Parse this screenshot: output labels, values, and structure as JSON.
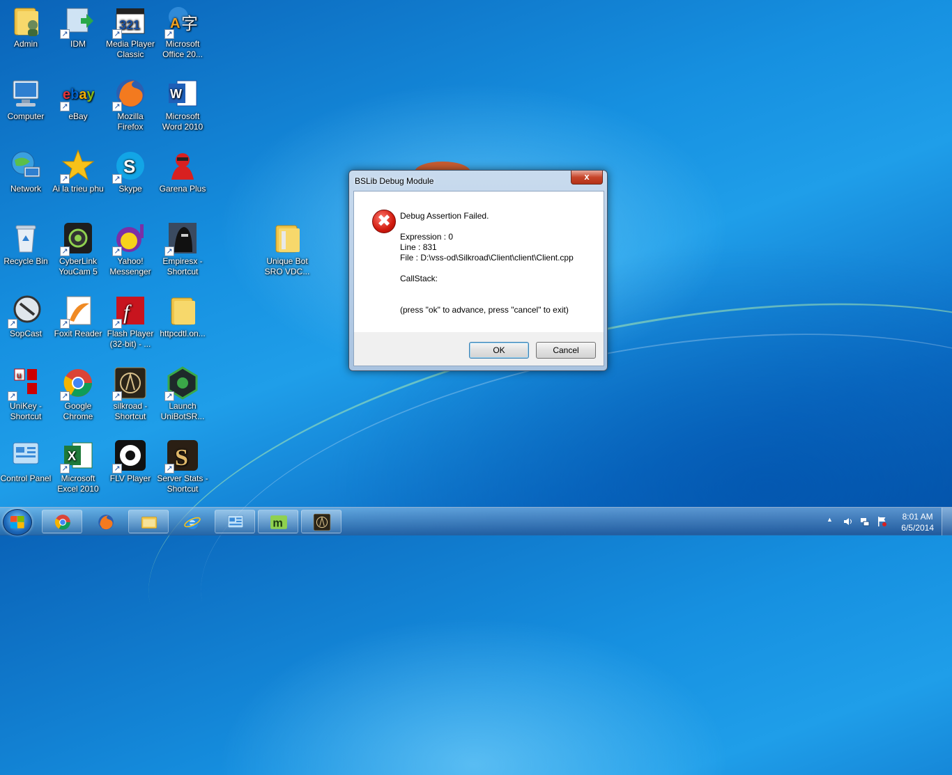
{
  "desktop": {
    "icons": [
      {
        "label": "Admin"
      },
      {
        "label": "IDM"
      },
      {
        "label": "Media Player Classic"
      },
      {
        "label": "Microsoft Office 20..."
      },
      {
        "label": "Computer"
      },
      {
        "label": "eBay"
      },
      {
        "label": "Mozilla Firefox"
      },
      {
        "label": "Microsoft Word 2010"
      },
      {
        "label": "Network"
      },
      {
        "label": "Ai la trieu phu"
      },
      {
        "label": "Skype"
      },
      {
        "label": "Garena Plus"
      },
      {
        "label": "Recycle Bin"
      },
      {
        "label": "CyberLink YouCam 5"
      },
      {
        "label": "Yahoo! Messenger"
      },
      {
        "label": "Empiresx - Shortcut"
      },
      {
        "label": "Unique Bot SRO VDC..."
      },
      {
        "label": "SopCast"
      },
      {
        "label": "Foxit Reader"
      },
      {
        "label": "Flash Player (32-bit) - ..."
      },
      {
        "label": "httpcdtl.on..."
      },
      {
        "label": "UniKey - Shortcut"
      },
      {
        "label": "Google Chrome"
      },
      {
        "label": "silkroad - Shortcut"
      },
      {
        "label": "Launch UniBotSR..."
      },
      {
        "label": "Control Panel"
      },
      {
        "label": "Microsoft Excel 2010"
      },
      {
        "label": "FLV Player"
      },
      {
        "label": "Server Stats - Shortcut"
      }
    ]
  },
  "dialog": {
    "title": "BSLib Debug Module",
    "close_glyph": "x",
    "error_glyph": "✖",
    "heading": "Debug Assertion Failed.",
    "expression": "Expression : 0",
    "line": "Line : 831",
    "file": "File : D:\\vss-od\\Silkroad\\Client\\client\\Client.cpp",
    "callstack": "CallStack:",
    "instruction": "(press \"ok\" to advance, press \"cancel\" to exit)",
    "ok_label": "OK",
    "cancel_label": "Cancel"
  },
  "taskbar": {
    "pinned": [
      "chrome-icon",
      "firefox-icon",
      "explorer-icon",
      "ie-icon",
      "control-panel-icon",
      "unibot-icon",
      "silkroad-icon"
    ],
    "tray": {
      "chevron": "▲",
      "time": "8:01 AM",
      "date": "6/5/2014"
    }
  }
}
